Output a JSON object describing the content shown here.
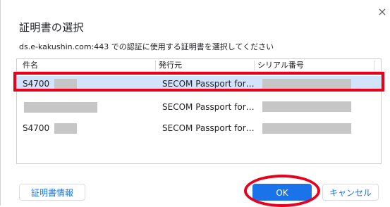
{
  "dialog": {
    "title": "証明書の選択",
    "description": "ds.e-kakushin.com:443 での認証に使用する証明書を選択してください",
    "close_glyph": "×"
  },
  "table": {
    "columns": [
      "件名",
      "発行元",
      "シリアル番号"
    ],
    "rows": [
      {
        "subject": "S4700",
        "issuer": "SECOM Passport for…",
        "serial": "",
        "selected": true
      },
      {
        "subject": "",
        "issuer": "SECOM Passport for…",
        "serial": "",
        "selected": false
      },
      {
        "subject": "S4700",
        "issuer": "SECOM Passport for…",
        "serial": "",
        "selected": false
      }
    ]
  },
  "buttons": {
    "cert_info": "証明書情報",
    "ok": "OK",
    "cancel": "キャンセル"
  },
  "colors": {
    "accent": "#1a73e8",
    "selected_row": "#d2e3fc",
    "annotation_red": "#e8001c",
    "redaction_gray": "#c6c6c6"
  },
  "icons": {
    "close": "close-icon"
  }
}
